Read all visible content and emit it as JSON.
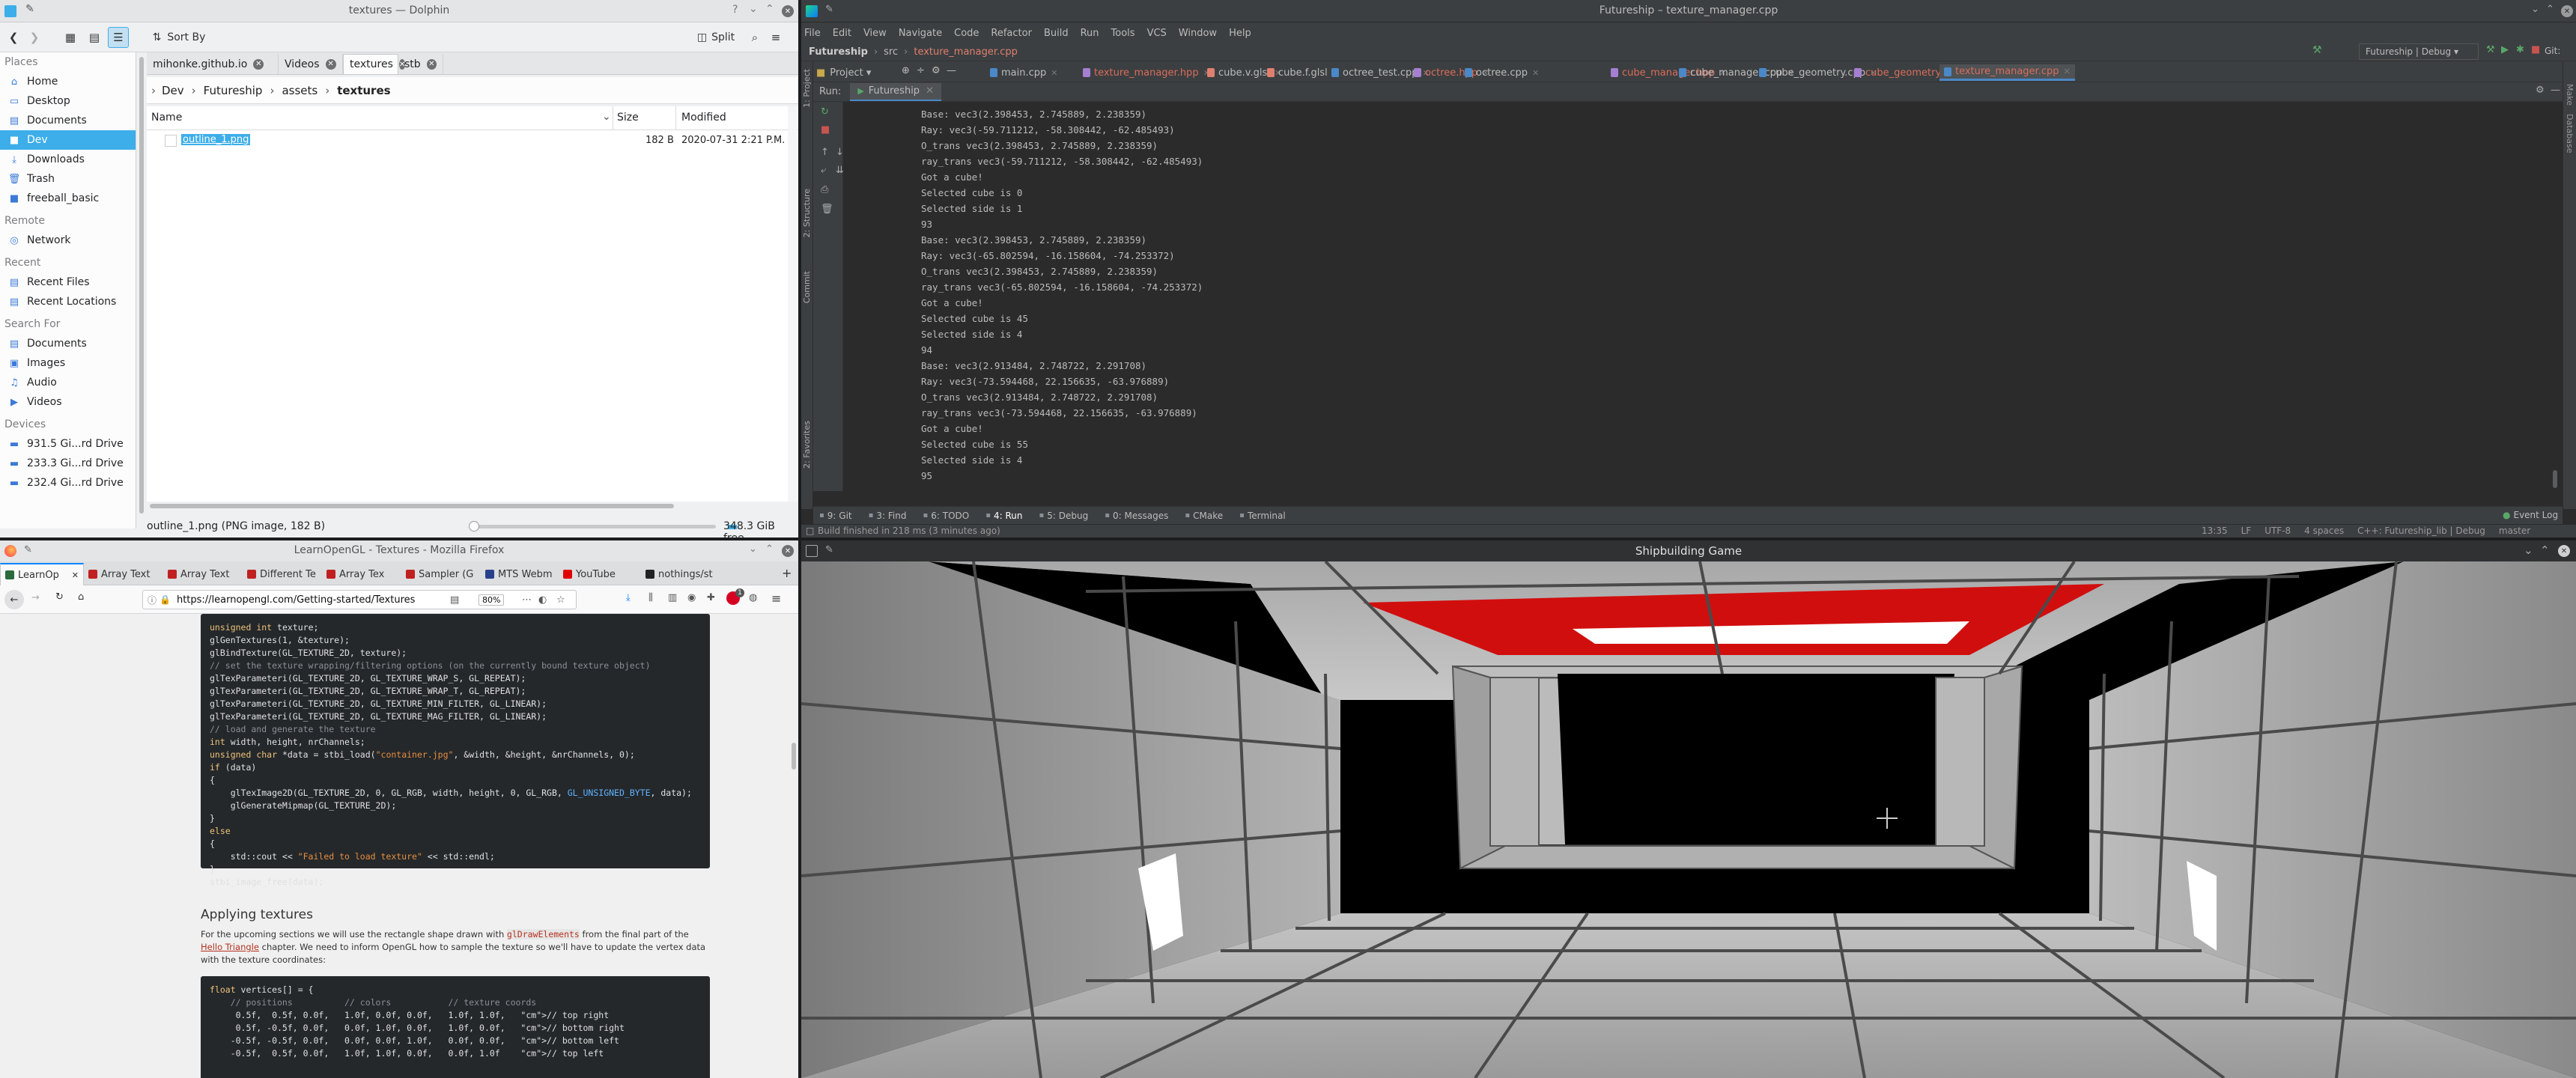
{
  "dolphin": {
    "title": "textures — Dolphin",
    "toolbar": {
      "sort_label": "Sort By",
      "split_label": "Split"
    },
    "places": {
      "sections": [
        {
          "heading": "Places",
          "items": [
            "Home",
            "Desktop",
            "Documents",
            "Dev",
            "Downloads",
            "Trash",
            "freeball_basic"
          ]
        },
        {
          "heading": "Remote",
          "items": [
            "Network"
          ]
        },
        {
          "heading": "Recent",
          "items": [
            "Recent Files",
            "Recent Locations"
          ]
        },
        {
          "heading": "Search For",
          "items": [
            "Documents",
            "Images",
            "Audio",
            "Videos"
          ]
        },
        {
          "heading": "Devices",
          "items": [
            "931.5 Gi...rd Drive",
            "233.3 Gi...rd Drive",
            "232.4 Gi...rd Drive"
          ]
        }
      ],
      "selected": "Dev"
    },
    "tabs": [
      "mihonke.github.io",
      "Videos",
      "textures",
      "stb"
    ],
    "active_tab": "textures",
    "breadcrumb": [
      "Dev",
      "Futureship",
      "assets",
      "textures"
    ],
    "columns": {
      "name": "Name",
      "size": "Size",
      "modified": "Modified"
    },
    "files": [
      {
        "name": "outline_1.png",
        "size": "182 B",
        "modified": "2020-07-31 2:21 P.M."
      }
    ],
    "status_left": "outline_1.png (PNG image, 182 B)",
    "status_right": "348.3 GiB free"
  },
  "clion": {
    "title": "Futureship – texture_manager.cpp",
    "menu": [
      "File",
      "Edit",
      "View",
      "Navigate",
      "Code",
      "Refactor",
      "Build",
      "Run",
      "Tools",
      "VCS",
      "Window",
      "Help"
    ],
    "nav": [
      "Futureship",
      "src",
      "texture_manager.cpp"
    ],
    "config": "Futureship | Debug",
    "git_label": "Git:",
    "project_label": "Project",
    "tabs": [
      "main.cpp",
      "texture_manager.hpp",
      "cube.v.glsl",
      "cube.f.glsl",
      "octree_test.cpp",
      "octree.hpp",
      "octree.cpp",
      "cube_manager.hpp",
      "cube_manager.cpp",
      "cube_geometry.cpp",
      "cube_geometry.hpp",
      "texture_manager.cpp"
    ],
    "active_tab": "texture_manager.cpp",
    "run_label": "Run:",
    "run_tab": "Futureship",
    "console": [
      "Base: vec3(2.398453, 2.745889, 2.238359)",
      "Ray: vec3(-59.711212, -58.308442, -62.485493)",
      "O_trans vec3(2.398453, 2.745889, 2.238359)",
      "ray_trans vec3(-59.711212, -58.308442, -62.485493)",
      "Got a cube!",
      "Selected cube is 0",
      "Selected side is 1",
      "93",
      "Base: vec3(2.398453, 2.745889, 2.238359)",
      "Ray: vec3(-65.802594, -16.158604, -74.253372)",
      "O_trans vec3(2.398453, 2.745889, 2.238359)",
      "ray_trans vec3(-65.802594, -16.158604, -74.253372)",
      "Got a cube!",
      "Selected cube is 45",
      "Selected side is 4",
      "94",
      "Base: vec3(2.913484, 2.748722, 2.291708)",
      "Ray: vec3(-73.594468, 22.156635, -63.976889)",
      "O_trans vec3(2.913484, 2.748722, 2.291708)",
      "ray_trans vec3(-73.594468, 22.156635, -63.976889)",
      "Got a cube!",
      "Selected cube is 55",
      "Selected side is 4",
      "95"
    ],
    "bottom_tabs": [
      "9: Git",
      "3: Find",
      "6: TODO",
      "4: Run",
      "5: Debug",
      "0: Messages",
      "CMake",
      "Terminal"
    ],
    "event_log": "Event Log",
    "left_strip": [
      "1: Project",
      "2: Structure",
      "Commit"
    ],
    "favorites": "2: Favorites",
    "status_left": "Build finished in 218 ms (3 minutes ago)",
    "status_right": [
      "13:35",
      "LF",
      "UTF-8",
      "4 spaces",
      "C++: Futureship_lib | Debug",
      "master"
    ]
  },
  "firefox": {
    "title": "LearnOpenGL - Textures - Mozilla Firefox",
    "tabs": [
      "LearnOp",
      "Array Text",
      "Array Text",
      "Different Te",
      "Array Tex",
      "Sampler (G",
      "MTS Webm",
      "YouTube",
      "nothings/st"
    ],
    "url": "https://learnopengl.com/Getting-started/Textures",
    "zoom": "80%",
    "badge": "1",
    "code1": [
      "unsigned int texture;",
      "glGenTextures(1, &texture);",
      "glBindTexture(GL_TEXTURE_2D, texture);",
      "// set the texture wrapping/filtering options (on the currently bound texture object)",
      "glTexParameteri(GL_TEXTURE_2D, GL_TEXTURE_WRAP_S, GL_REPEAT);",
      "glTexParameteri(GL_TEXTURE_2D, GL_TEXTURE_WRAP_T, GL_REPEAT);",
      "glTexParameteri(GL_TEXTURE_2D, GL_TEXTURE_MIN_FILTER, GL_LINEAR);",
      "glTexParameteri(GL_TEXTURE_2D, GL_TEXTURE_MAG_FILTER, GL_LINEAR);",
      "// load and generate the texture",
      "int width, height, nrChannels;",
      "unsigned char *data = stbi_load(\"container.jpg\", &width, &height, &nrChannels, 0);",
      "if (data)",
      "{",
      "    glTexImage2D(GL_TEXTURE_2D, 0, GL_RGB, width, height, 0, GL_RGB, GL_UNSIGNED_BYTE, data);",
      "    glGenerateMipmap(GL_TEXTURE_2D);",
      "}",
      "else",
      "{",
      "    std::cout << \"Failed to load texture\" << std::endl;",
      "}",
      "stbi_image_free(data);"
    ],
    "heading": "Applying textures",
    "para_parts": [
      "For the upcoming sections we will use the rectangle shape drawn with ",
      "glDrawElements",
      " from the final part of the ",
      "Hello Triangle",
      " chapter. We need to inform OpenGL how to sample the texture so we'll have to update the vertex data with the texture coordinates:"
    ],
    "code2": [
      "float vertices[] = {",
      "    // positions          // colors           // texture coords",
      "     0.5f,  0.5f, 0.0f,   1.0f, 0.0f, 0.0f,   1.0f, 1.0f,   // top right",
      "     0.5f, -0.5f, 0.0f,   0.0f, 1.0f, 0.0f,   1.0f, 0.0f,   // bottom right",
      "    -0.5f, -0.5f, 0.0f,   0.0f, 0.0f, 1.0f,   0.0f, 0.0f,   // bottom left",
      "    -0.5f,  0.5f, 0.0f,   1.0f, 1.0f, 0.0f,   0.0f, 1.0f    // top left"
    ]
  },
  "game": {
    "title": "Shipbuilding Game"
  }
}
